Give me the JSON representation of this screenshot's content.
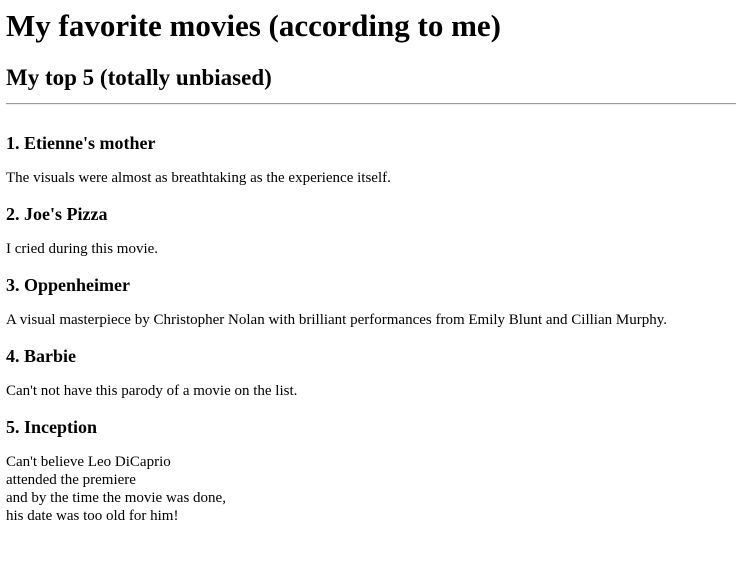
{
  "page": {
    "title": "My favorite movies (according to me)",
    "subtitle": "My top 5 (totally unbiased)"
  },
  "movies": [
    {
      "heading": "1. Etienne's mother",
      "description": "The visuals were almost as breathtaking as the experience itself."
    },
    {
      "heading": "2. Joe's Pizza",
      "description": "I cried during this movie."
    },
    {
      "heading": "3. Oppenheimer",
      "description": "A visual masterpiece by Christopher Nolan with brilliant performances from Emily Blunt and Cillian Murphy."
    },
    {
      "heading": "4. Barbie",
      "description": "Can't not have this parody of a movie on the list."
    },
    {
      "heading": "5. Inception",
      "description": "Can't believe Leo DiCaprio\nattended the premiere\nand by the time the movie was done,\nhis date was too old for him!"
    }
  ]
}
